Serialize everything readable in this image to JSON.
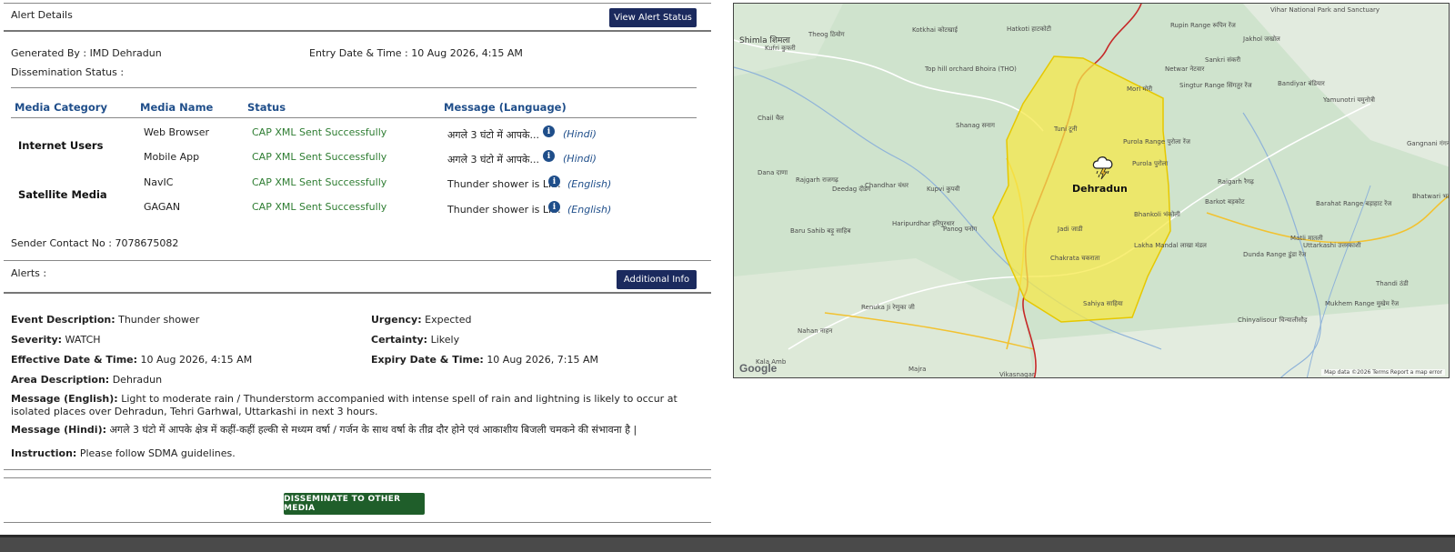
{
  "alert_details": {
    "title": "Alert Details",
    "view_status_button": "View Alert Status",
    "generated_by": "Generated By : IMD Dehradun",
    "entry_date": "Entry Date & Time : 10 Aug 2026, 4:15 AM",
    "dissemination_status": "Dissemination Status :",
    "table": {
      "headers": [
        "Media Category",
        "Media Name",
        "Status",
        "Message (Language)"
      ],
      "categories": [
        "Internet Users",
        "Satellite Media"
      ],
      "rows": [
        {
          "media": "Web Browser",
          "status": "CAP XML Sent Successfully",
          "message": "अगले 3 घंटो में आपके...",
          "language": "(Hindi)"
        },
        {
          "media": "Mobile App",
          "status": "CAP XML Sent Successfully",
          "message": "अगले 3 घंटो में आपके...",
          "language": "(Hindi)"
        },
        {
          "media": "NavIC",
          "status": "CAP XML Sent Successfully",
          "message": "Thunder shower is Li...",
          "language": "(English)"
        },
        {
          "media": "GAGAN",
          "status": "CAP XML Sent Successfully",
          "message": "Thunder shower is Li...",
          "language": "(English)"
        }
      ]
    },
    "sender_contact": "Sender Contact No : 7078675082"
  },
  "alerts": {
    "title": "Alerts :",
    "additional_info_button": "Additional Info",
    "event_label": "Event Description:",
    "event_value": "Thunder shower",
    "urgency_label": "Urgency:",
    "urgency_value": "Expected",
    "severity_label": "Severity:",
    "severity_value": "WATCH",
    "certainty_label": "Certainty:",
    "certainty_value": "Likely",
    "effective_label": "Effective Date & Time:",
    "effective_value": "10 Aug 2026, 4:15 AM",
    "expiry_label": "Expiry Date & Time:",
    "expiry_value": "10 Aug 2026, 7:15 AM",
    "area_label": "Area Description:",
    "area_value": "Dehradun",
    "msg_en_label": "Message (English):",
    "msg_en_value": "Light to moderate rain / Thunderstorm accompanied with intense spell of rain and lightning is likely to occur at isolated places over Dehradun, Tehri Garhwal, Uttarkashi in next 3 hours.",
    "msg_hi_label": "Message (Hindi):",
    "msg_hi_value": "अगले 3 घंटो में आपके क्षेत्र में कहीं-कहीं हल्की से मध्यम वर्षा / गर्जन के साथ वर्षा के तीव्र दौर होने एवं आकाशीय बिजली चमकने की संभावना है |",
    "instruction_label": "Instruction:",
    "instruction_value": "Please follow SDMA guidelines.",
    "disseminate_button": "DISSEMINATE TO OTHER MEDIA"
  },
  "map": {
    "center_label": "Dehradun",
    "google": "Google",
    "attribution": "Map data ©2026   Terms   Report a map error",
    "places": [
      "Shimla शिमला",
      "Theog ठियोग",
      "Kotkhai कोटखाई",
      "Hatkoti हाटकोटी",
      "Rupin Range रूपिन रेंज",
      "Vihar National Park and Sanctuary",
      "Kufri कुफरी",
      "Top hill orchard Bhoira (THO)",
      "Jakhol जखोल",
      "Sankri संकरी",
      "Netwar नेटवार",
      "Mori मोरी",
      "Singtur Range सिंगतुर रेंज",
      "Bandiyar बंडियार",
      "Yamunotri यमुनोत्री",
      "Chail चैल",
      "Shanag सनाग",
      "Gangnani गंगनानी",
      "Purola Range पुरोला रेंज",
      "Purola पुरोला",
      "Dana दाणा",
      "Rajgarh राजगढ़",
      "Deedag दीडग",
      "Chandhar चंधर",
      "Kupvi कुपवी",
      "Raigarh रैगढ़",
      "Barkot बड़कोट",
      "Barahat Range बड़ाहाट रेंज",
      "Bhatwari भटवारी",
      "Baru Sahib बड़ू साहिब",
      "Haripurdhar हरिपुरधार",
      "Panog पनोग",
      "Bhankoli भंकोली",
      "Matli मातली",
      "Uttarkashi उत्तरकाशी",
      "Lakha Mandal लाखा मंडल",
      "Dunda Range डुंडा रेंज",
      "Chakrata चकराता",
      "Renuka Ji रेणुका जी",
      "Thandi ठंडी",
      "Mukhem Range मुखेम रेंज",
      "Nahan नाहन",
      "Chinyalisour चिन्यालीसौड़",
      "Kala Amb",
      "Majra",
      "Vikasnagar",
      "Tuni टूनी",
      "Jadi जाडी",
      "Sahiya साहिया"
    ]
  }
}
